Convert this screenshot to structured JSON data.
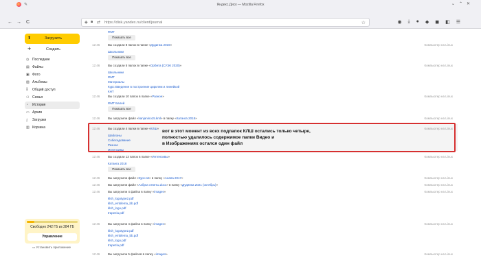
{
  "browser": {
    "title": "Яндекс.Диск — Mozilla Firefox",
    "url": "https://disk.yandex.ru/client/journal",
    "back": "←",
    "forward": "→",
    "reload": "C",
    "window_controls": [
      "⌄",
      "⌃",
      "✕"
    ],
    "toolbar_icons": [
      "shield-icon",
      "download-icon",
      "account-icon",
      "extension-icon",
      "extension-icon-2",
      "tabs-icon",
      "menu-icon"
    ]
  },
  "sidebar": {
    "upload_label": "Загрузить",
    "create_label": "Создать",
    "items": [
      {
        "label": "Последние",
        "icon": "clock-icon",
        "glyph": "◷",
        "active": false
      },
      {
        "label": "Файлы",
        "icon": "folder-icon",
        "glyph": "▤",
        "active": false
      },
      {
        "label": "Фото",
        "icon": "photo-icon",
        "glyph": "▣",
        "active": false
      },
      {
        "label": "Альбомы",
        "icon": "album-icon",
        "glyph": "▨",
        "active": false
      },
      {
        "label": "Общий доступ",
        "icon": "share-icon",
        "glyph": "⁑",
        "active": false
      },
      {
        "label": "Семья",
        "icon": "family-icon",
        "glyph": "⚇",
        "active": false
      },
      {
        "label": "История",
        "icon": "history-icon",
        "glyph": "◔",
        "active": true
      },
      {
        "label": "Архив",
        "icon": "archive-icon",
        "glyph": "▭",
        "active": false
      },
      {
        "label": "Загрузки",
        "icon": "downloads-icon",
        "glyph": "⤓",
        "active": false
      },
      {
        "label": "Корзина",
        "icon": "trash-icon",
        "glyph": "▥",
        "active": false
      }
    ],
    "storage_text": "Свободно 242 ГБ из 284 ГБ",
    "storage_used_fraction": 0.15,
    "manage_label": "Управление",
    "install_app_label": "Установить приложение"
  },
  "journal": [
    {
      "time": "",
      "parts": [],
      "files": [
        "ФМТ"
      ],
      "show_all": "Показать все"
    },
    {
      "time": "12:46",
      "parts": [
        {
          "t": "Вы создали 8 папок в папке «"
        },
        {
          "t": "Дудинка 2019",
          "link": true
        },
        {
          "t": "»"
        }
      ],
      "files": [
        "Школьники"
      ],
      "show_all": "Показать все"
    },
    {
      "time": "12:46",
      "parts": [
        {
          "t": "Вы создали 5 папок в папке «"
        },
        {
          "t": "Орбита (СУЭК 2020)",
          "link": true
        },
        {
          "t": "»"
        }
      ],
      "files": [
        "Школьники",
        "ФМТ",
        "Материалы",
        "Курс Введение в построение цирклем и линейкой",
        "КНТ"
      ],
      "show_all": ""
    },
    {
      "time": "12:46",
      "parts": [
        {
          "t": "Вы создали 10 папок в папке «"
        },
        {
          "t": "Разное",
          "link": true
        },
        {
          "t": "»"
        }
      ],
      "files": [
        "ФМТ Балей"
      ],
      "show_all": "Показать все"
    },
    {
      "time": "12:46",
      "parts": [
        {
          "t": "Вы загрузили файл «"
        },
        {
          "t": "kanjanino15.kml",
          "link": true
        },
        {
          "t": "» в папку «"
        },
        {
          "t": "Катанга 2018",
          "link": true
        },
        {
          "t": "»"
        }
      ],
      "files": [],
      "show_all": ""
    },
    {
      "time": "12:46",
      "parts": [
        {
          "t": "Вы создали 4 папки в папке «"
        },
        {
          "t": "КЛШ",
          "link": true
        },
        {
          "t": "»"
        }
      ],
      "files": [
        "Шаблоны",
        "Собеседование",
        "Разное",
        "Интенсивы"
      ],
      "show_all": ""
    },
    {
      "time": "12:46",
      "parts": [
        {
          "t": "Вы создали 13 папок в папке «"
        },
        {
          "t": "Интенсивы",
          "link": true
        },
        {
          "t": "»"
        }
      ],
      "files": [
        "Катанга 2018"
      ],
      "show_all": "Показать все"
    },
    {
      "time": "12:46",
      "parts": [
        {
          "t": "Вы загрузили файл «"
        },
        {
          "t": "Курс.txt",
          "link": true
        },
        {
          "t": "» в папку «"
        },
        {
          "t": "Анапа 2017",
          "link": true
        },
        {
          "t": "»"
        }
      ],
      "files": [],
      "show_all": ""
    },
    {
      "time": "12:46",
      "parts": [
        {
          "t": "Вы загрузили файл «"
        },
        {
          "t": "Азбука ответы.docx",
          "link": true
        },
        {
          "t": "» в папку «"
        },
        {
          "t": "Дудинка 2021 (октябрь)",
          "link": true
        },
        {
          "t": "»"
        }
      ],
      "files": [],
      "show_all": ""
    },
    {
      "time": "12:46",
      "parts": [
        {
          "t": "Вы загрузили 4 файла в папку «"
        },
        {
          "t": "images",
          "link": true
        },
        {
          "t": "»"
        }
      ],
      "files": [
        "klsh_logotype2.pdf",
        "klsh_emblema_bb.pdf",
        "klsh_logo.pdf",
        "trapezia.pdf"
      ],
      "show_all": ""
    },
    {
      "time": "12:46",
      "parts": [
        {
          "t": "Вы загрузили 4 файла в папку «"
        },
        {
          "t": "images",
          "link": true
        },
        {
          "t": "»"
        }
      ],
      "files": [
        "klsh_logotype2.pdf",
        "klsh_emblema_bb.pdf",
        "klsh_logo.pdf",
        "trapezia.pdf"
      ],
      "show_all": ""
    },
    {
      "time": "12:46",
      "parts": [
        {
          "t": "Вы загрузили 5 файлов в папку «"
        },
        {
          "t": "images",
          "link": true
        },
        {
          "t": "»"
        }
      ],
      "files": [],
      "show_all": ""
    }
  ],
  "device_label": "Компьютер на Linux",
  "annotation": [
    "вот в этот момент из всех подпапок КЛШ остались только четыре,",
    "полностью удалилось содержимое папки Видео и",
    "в Изображениях остался один файл"
  ],
  "colors": {
    "accent": "#ffcc00",
    "link": "#1e5ecf",
    "annotation_border": "#d63030"
  }
}
